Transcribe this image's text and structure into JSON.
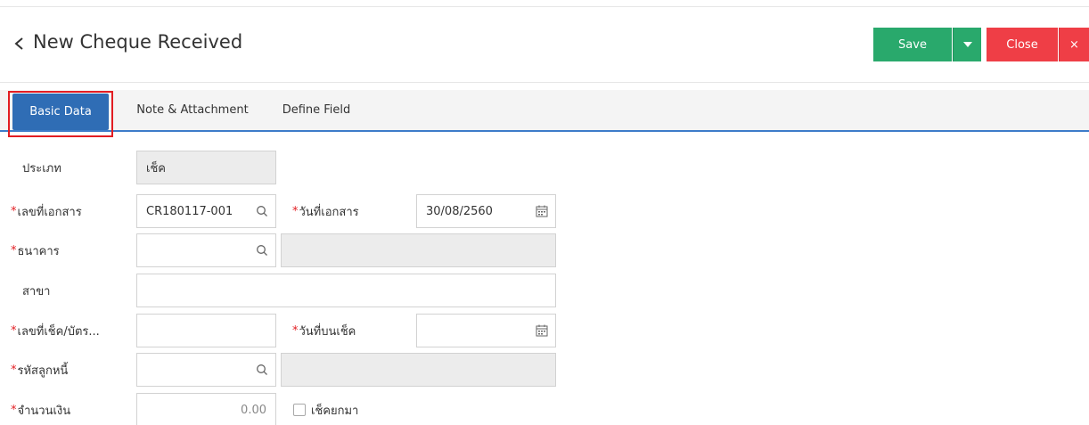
{
  "header": {
    "title": "New Cheque Received",
    "save_label": "Save",
    "close_label": "Close",
    "close_x": "×"
  },
  "tabs": [
    {
      "label": "Basic Data",
      "active": true
    },
    {
      "label": "Note & Attachment",
      "active": false
    },
    {
      "label": "Define Field",
      "active": false
    }
  ],
  "form": {
    "type_label": "ประเภท",
    "type_value": "เช็ค",
    "doc_no_label": "เลขที่เอกสาร",
    "doc_no_value": "CR180117-001",
    "doc_date_label": "วันที่เอกสาร",
    "doc_date_value": "30/08/2560",
    "bank_label": "ธนาคาร",
    "branch_label": "สาขา",
    "cheque_no_label": "เลขที่เช็ค/บัตร...",
    "cheque_date_label": "วันที่บนเช็ค",
    "debtor_code_label": "รหัสลูกหนี้",
    "amount_label": "จำนวนเงิน",
    "amount_value": "0.00",
    "carry_forward_label": "เช็คยกมา"
  },
  "colors": {
    "save": "#29a96c",
    "close": "#ef3e46",
    "tab_active": "#2f6db5",
    "required": "#e21d22"
  },
  "icons": [
    "chevron-left-icon",
    "caret-down-icon",
    "close-icon",
    "search-icon",
    "calendar-icon"
  ]
}
